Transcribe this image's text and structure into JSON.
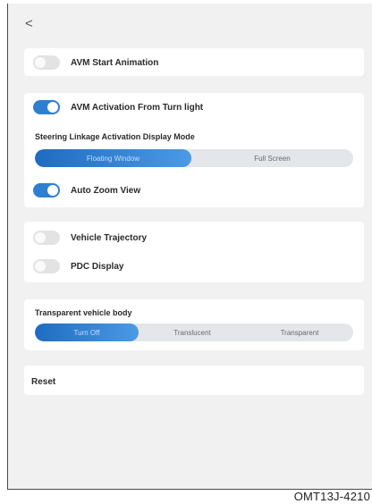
{
  "nav": {
    "back_glyph": "<",
    "back_icon": "chevron-left-icon"
  },
  "card1": {
    "avm_start_animation": {
      "label": "AVM Start Animation",
      "on": false
    }
  },
  "card2": {
    "avm_activation_turn_light": {
      "label": "AVM Activation From Turn light",
      "on": true
    },
    "steering_mode": {
      "title": "Steering Linkage Activation Display Mode",
      "options": [
        "Floating Window",
        "Full Screen"
      ],
      "selected": "Floating Window"
    },
    "auto_zoom_view": {
      "label": "Auto Zoom View",
      "on": true
    }
  },
  "card3": {
    "vehicle_trajectory": {
      "label": "Vehicle Trajectory",
      "on": false
    },
    "pdc_display": {
      "label": "PDC Display",
      "on": false
    }
  },
  "card4": {
    "transparent_body": {
      "title": "Transparent vehicle body",
      "options": [
        "Turn Off",
        "Translucent",
        "Transparent"
      ],
      "selected": "Turn Off"
    }
  },
  "card5": {
    "reset_label": "Reset"
  },
  "figure_code": "OMT13J-4210",
  "colors": {
    "accent": "#2f7fd1",
    "toggle_off": "#e3e3e3",
    "background": "#f1f1f1",
    "card": "#ffffff"
  }
}
